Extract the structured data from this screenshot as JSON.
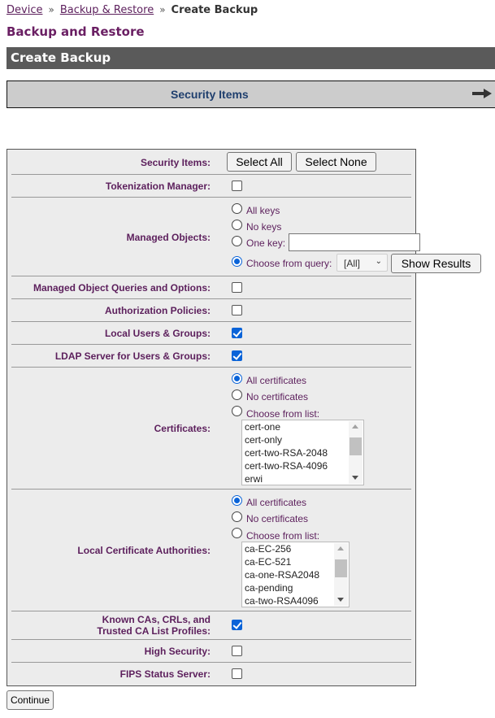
{
  "breadcrumb": {
    "items": [
      "Device",
      "Backup & Restore"
    ],
    "separator": "»",
    "current": "Create Backup"
  },
  "app_title": "Backup and Restore",
  "section_title": "Create Backup",
  "wizard": {
    "step_label": "Security Items",
    "next_icon": "arrow-right-icon"
  },
  "form": {
    "security_items": {
      "label": "Security Items:",
      "select_all": "Select All",
      "select_none": "Select None"
    },
    "tokenization_manager": {
      "label": "Tokenization Manager:",
      "checked": false
    },
    "managed_objects": {
      "label": "Managed Objects:",
      "options": [
        {
          "label": "All keys",
          "selected": false
        },
        {
          "label": "No keys",
          "selected": false
        },
        {
          "label": "One key:",
          "selected": false
        },
        {
          "label": "Choose from query:",
          "selected": true
        }
      ],
      "one_key_value": "",
      "query_select_value": "[All]",
      "show_results": "Show Results"
    },
    "managed_object_queries": {
      "label": "Managed Object Queries and Options:",
      "checked": false
    },
    "authorization_policies": {
      "label": "Authorization Policies:",
      "checked": false
    },
    "local_users_groups": {
      "label": "Local Users & Groups:",
      "checked": true
    },
    "ldap_server": {
      "label": "LDAP Server for Users & Groups:",
      "checked": true
    },
    "certificates": {
      "label": "Certificates:",
      "options": [
        {
          "label": "All certificates",
          "selected": true
        },
        {
          "label": "No certificates",
          "selected": false
        },
        {
          "label": "Choose from list:",
          "selected": false
        }
      ],
      "list": [
        "cert-one",
        "cert-only",
        "cert-two-RSA-2048",
        "cert-two-RSA-4096",
        "erwi"
      ]
    },
    "local_cas": {
      "label": "Local Certificate Authorities:",
      "options": [
        {
          "label": "All certificates",
          "selected": true
        },
        {
          "label": "No certificates",
          "selected": false
        },
        {
          "label": "Choose from list:",
          "selected": false
        }
      ],
      "list": [
        "ca-EC-256",
        "ca-EC-521",
        "ca-one-RSA2048",
        "ca-pending",
        "ca-two-RSA4096"
      ]
    },
    "known_cas": {
      "label_line1": "Known CAs, CRLs, and",
      "label_line2": "Trusted CA List Profiles:",
      "checked": true
    },
    "high_security": {
      "label": "High Security:",
      "checked": false
    },
    "fips_status_server": {
      "label": "FIPS Status Server:",
      "checked": false
    }
  },
  "continue_label": "Continue"
}
